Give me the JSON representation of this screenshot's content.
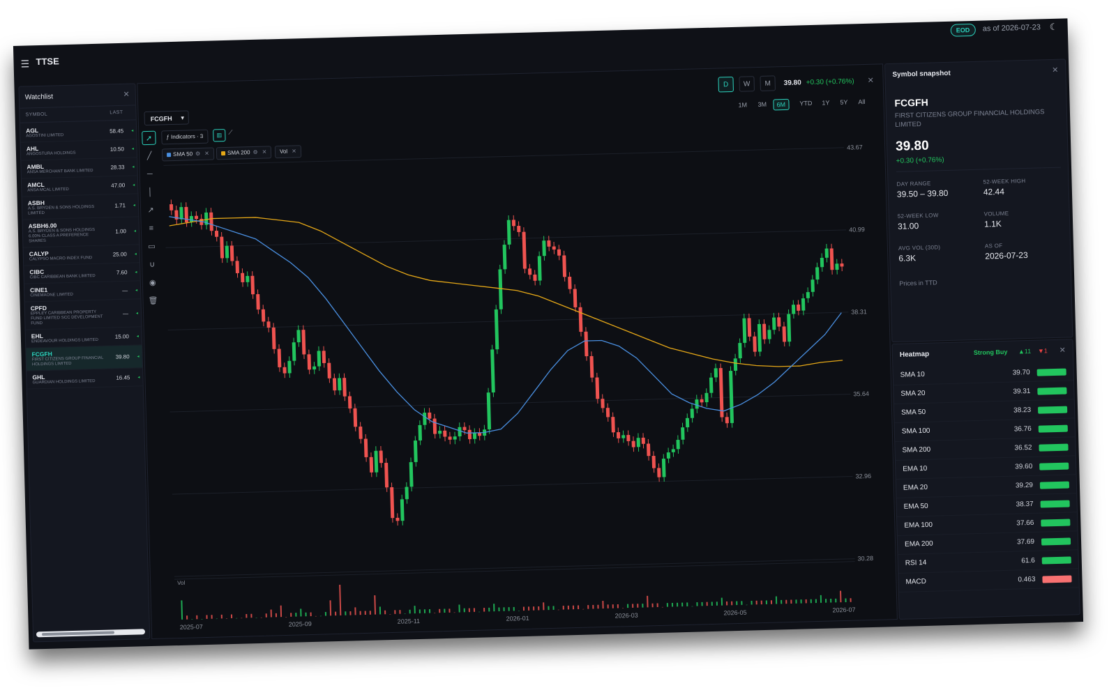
{
  "app": {
    "title": "TTSE",
    "eod_badge": "EOD",
    "as_of": "as of 2026-07-23"
  },
  "watchlist": {
    "title": "Watchlist",
    "col_symbol": "SYMBOL",
    "col_last": "LAST",
    "items": [
      {
        "symbol": "AGL",
        "name": "AGOSTINI LIMITED",
        "last": "58.45"
      },
      {
        "symbol": "AHL",
        "name": "Angostura Holdings",
        "last": "10.50"
      },
      {
        "symbol": "AMBL",
        "name": "ANSA MERCHANT BANK LIMITED",
        "last": "28.33"
      },
      {
        "symbol": "AMCL",
        "name": "ANSA McAL LIMITED",
        "last": "47.00"
      },
      {
        "symbol": "ASBH",
        "name": "A.S. BRYDEN & SONS HOLDINGS LIMITED",
        "last": "1.71"
      },
      {
        "symbol": "ASBH6.00",
        "name": "A.S. BRYDEN & SONS HOLDINGS 6.00% CLASS A PREFERENCE SHARES",
        "last": "1.00"
      },
      {
        "symbol": "CALYP",
        "name": "CALYPSO MACRO INDEX FUND",
        "last": "25.00"
      },
      {
        "symbol": "CIBC",
        "name": "CIBC CARIBBEAN BANK LIMITED",
        "last": "7.60"
      },
      {
        "symbol": "CINE1",
        "name": "CINEMAONE LIMITED",
        "last": "—"
      },
      {
        "symbol": "CPFD",
        "name": "EPPLEY CARIBBEAN PROPERTY FUND LIMITED SCC DEVELOPMENT FUND",
        "last": "—"
      },
      {
        "symbol": "EHL",
        "name": "ENDEAVOUR HOLDINGS LIMITED",
        "last": "15.00"
      },
      {
        "symbol": "FCGFH",
        "name": "FIRST CITIZENS GROUP FINANCIAL HOLDINGS LIMITED",
        "last": "39.80",
        "active": true
      },
      {
        "symbol": "GHL",
        "name": "GUARDIAN HOLDINGS LIMITED",
        "last": "16.45"
      }
    ]
  },
  "chart_panel": {
    "symbol": "FCGFH",
    "intervals": [
      "D",
      "W",
      "M"
    ],
    "active_interval": "D",
    "price": "39.80",
    "change": "+0.30 (+0.76%)",
    "ranges": [
      "1M",
      "3M",
      "6M",
      "YTD",
      "1Y",
      "5Y",
      "All"
    ],
    "active_range": "6M",
    "indicators_label": "ƒ Indicators · 3",
    "chips": [
      {
        "label": "SMA 50",
        "color": "#4a90e2"
      },
      {
        "label": "SMA 200",
        "color": "#e6a817"
      },
      {
        "label": "Vol"
      }
    ],
    "vol_label": "Vol",
    "tools": [
      "cursor-icon",
      "trend-line-icon",
      "horizontal-line-icon",
      "vertical-line-icon",
      "ray-icon",
      "fib-icon",
      "rectangle-icon",
      "magnet-icon",
      "eye-icon",
      "trash-icon"
    ]
  },
  "chart_data": {
    "type": "candlestick",
    "x_ticks": [
      "2025-07",
      "2025-09",
      "2025-11",
      "2026-01",
      "2026-03",
      "2026-05",
      "2026-07"
    ],
    "y_ticks": [
      "43.67",
      "40.99",
      "38.31",
      "35.64",
      "32.96",
      "30.28"
    ],
    "ylim": [
      30.28,
      43.67
    ],
    "close": [
      42.2,
      41.9,
      42.3,
      41.8,
      42.0,
      41.9,
      41.7,
      42.1,
      41.5,
      41.3,
      40.6,
      41.0,
      40.5,
      40.1,
      39.8,
      40.0,
      39.4,
      38.9,
      38.5,
      38.3,
      37.6,
      37.0,
      36.8,
      37.2,
      37.8,
      38.2,
      37.4,
      36.9,
      37.0,
      37.5,
      37.1,
      36.6,
      36.2,
      36.6,
      36.0,
      35.6,
      35.0,
      34.6,
      34.0,
      33.5,
      34.2,
      33.8,
      33.0,
      32.0,
      31.9,
      32.6,
      33.0,
      33.8,
      34.5,
      35.0,
      35.4,
      35.2,
      34.7,
      34.8,
      34.6,
      34.5,
      34.6,
      34.9,
      34.8,
      34.5,
      34.7,
      34.6,
      34.8,
      36.0,
      37.4,
      38.7,
      40.0,
      40.8,
      41.6,
      41.4,
      41.2,
      40.0,
      39.8,
      39.6,
      40.4,
      40.9,
      40.7,
      40.6,
      40.4,
      39.7,
      39.3,
      38.7,
      37.9,
      37.1,
      36.4,
      35.7,
      35.4,
      35.1,
      34.6,
      34.4,
      34.5,
      34.3,
      34.1,
      34.4,
      34.2,
      33.8,
      33.4,
      33.1,
      33.7,
      33.9,
      34.0,
      34.3,
      34.7,
      35.0,
      35.3,
      35.6,
      35.5,
      35.8,
      36.3,
      36.6,
      35.0,
      34.8,
      36.5,
      36.9,
      37.4,
      38.2,
      37.6,
      37.1,
      38.0,
      37.5,
      37.8,
      38.2,
      37.9,
      37.4,
      38.3,
      38.6,
      38.4,
      38.8,
      39.0,
      39.4,
      39.8,
      40.1,
      40.4,
      39.7,
      39.9,
      39.8
    ],
    "sma50": [
      42.0,
      41.9,
      41.8,
      41.6,
      41.4,
      41.2,
      40.8,
      40.4,
      39.9,
      39.2,
      38.4,
      37.6,
      36.8,
      36.1,
      35.5,
      35.1,
      34.9,
      34.7,
      34.7,
      34.8,
      35.3,
      36.0,
      36.7,
      37.3,
      37.6,
      37.6,
      37.4,
      37.0,
      36.4,
      35.8,
      35.5,
      35.3,
      35.2,
      35.4,
      35.7,
      36.1,
      36.6,
      37.1,
      37.6,
      38.3
    ],
    "sma200": [
      41.7,
      41.8,
      41.9,
      41.9,
      41.9,
      41.8,
      41.7,
      41.4,
      41.0,
      40.6,
      40.2,
      39.9,
      39.7,
      39.6,
      39.5,
      39.4,
      39.3,
      39.1,
      38.8,
      38.5,
      38.2,
      37.9,
      37.6,
      37.3,
      37.1,
      36.9,
      36.75,
      36.65,
      36.6,
      36.6,
      36.7,
      36.75
    ],
    "volume": [
      5,
      1,
      0,
      1,
      0,
      1,
      1,
      0,
      1,
      0,
      1,
      0,
      0,
      1,
      1,
      0,
      0,
      1,
      2,
      1,
      3,
      0,
      1,
      1,
      2,
      1,
      1,
      0,
      0,
      1,
      4,
      1,
      8,
      1,
      1,
      2,
      1,
      1,
      1,
      5,
      2,
      1,
      0,
      1,
      1,
      0,
      1,
      2,
      1,
      1,
      1,
      0,
      1,
      1,
      1,
      0,
      2,
      1,
      1,
      1,
      0,
      1,
      1,
      2,
      1,
      1,
      1,
      1,
      0,
      1,
      1,
      1,
      1,
      2,
      1,
      1,
      0,
      1,
      1,
      1,
      1,
      0,
      1,
      1,
      1,
      2,
      1,
      1,
      1,
      0,
      1,
      1,
      1,
      1,
      3,
      1,
      1,
      0,
      1,
      1,
      1,
      1,
      1,
      0,
      1,
      1,
      1,
      1,
      1,
      2,
      1,
      1,
      1,
      1,
      0,
      1,
      1,
      1,
      1,
      1,
      2,
      1,
      1,
      1,
      1,
      1,
      1,
      1,
      1,
      2,
      1,
      1,
      1,
      3,
      1,
      1
    ]
  },
  "snapshot": {
    "title": "Symbol snapshot",
    "symbol": "FCGFH",
    "name": "FIRST CITIZENS GROUP FINANCIAL HOLDINGS LIMITED",
    "price": "39.80",
    "change": "+0.30 (+0.76%)",
    "stats": [
      {
        "label": "DAY RANGE",
        "value": "39.50 – 39.80"
      },
      {
        "label": "52-WEEK HIGH",
        "value": "42.44"
      },
      {
        "label": "52-WEEK LOW",
        "value": "31.00"
      },
      {
        "label": "VOLUME",
        "value": "1.1K"
      },
      {
        "label": "AVG VOL (30D)",
        "value": "6.3K"
      },
      {
        "label": "AS OF",
        "value": "2026-07-23"
      }
    ],
    "note": "Prices in TTD"
  },
  "heatmap": {
    "title": "Heatmap",
    "signal": "Strong Buy",
    "up": "▲11",
    "down": "▼1",
    "rows": [
      {
        "name": "SMA 10",
        "value": "39.70",
        "color": "#22c55e"
      },
      {
        "name": "SMA 20",
        "value": "39.31",
        "color": "#22c55e"
      },
      {
        "name": "SMA 50",
        "value": "38.23",
        "color": "#22c55e"
      },
      {
        "name": "SMA 100",
        "value": "36.76",
        "color": "#22c55e"
      },
      {
        "name": "SMA 200",
        "value": "36.52",
        "color": "#22c55e"
      },
      {
        "name": "EMA 10",
        "value": "39.60",
        "color": "#22c55e"
      },
      {
        "name": "EMA 20",
        "value": "39.29",
        "color": "#22c55e"
      },
      {
        "name": "EMA 50",
        "value": "38.37",
        "color": "#22c55e"
      },
      {
        "name": "EMA 100",
        "value": "37.66",
        "color": "#22c55e"
      },
      {
        "name": "EMA 200",
        "value": "37.69",
        "color": "#22c55e"
      },
      {
        "name": "RSI 14",
        "value": "61.6",
        "color": "#22c55e"
      },
      {
        "name": "MACD",
        "value": "0.463",
        "color": "#f87171"
      }
    ]
  }
}
